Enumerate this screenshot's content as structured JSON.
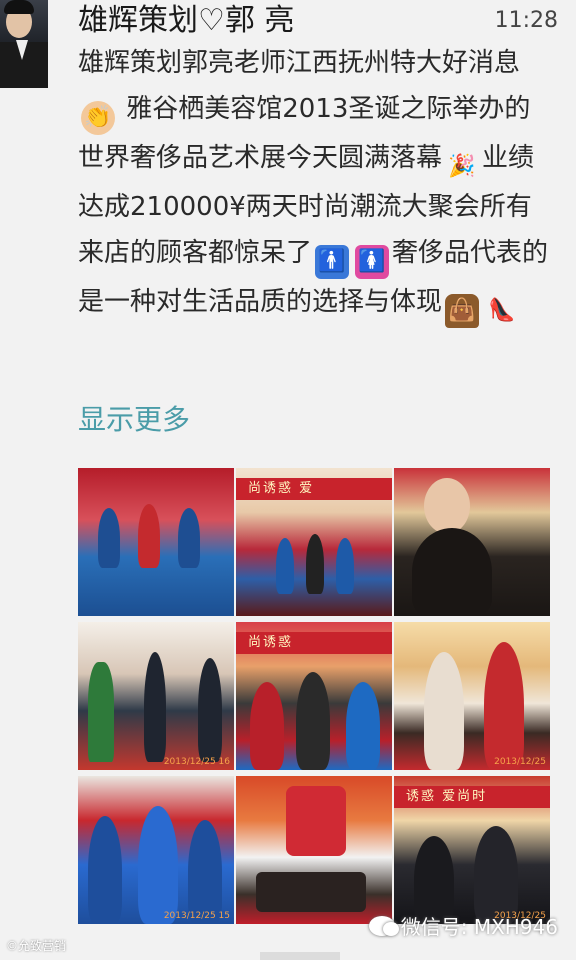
{
  "post": {
    "sender": "雄辉策划♡郭 亮",
    "time": "11:28",
    "text_1": "雄辉策划郭亮老师江西抚州特大好消息",
    "emoji_clap": "👏",
    "text_2": " 雅谷栖美容馆2013圣诞之际举办的世界奢侈品艺术展今天圆满落幕",
    "emoji_party": "🎉",
    "text_3": "业绩达成210000¥两天时尚潮流大聚会所有来店的顾客都惊呆了",
    "emoji_man": "🚹",
    "emoji_woman": "🚺",
    "text_4": "奢侈品代表的是一种对生活品质的选择与体现",
    "emoji_bag": "👜",
    "emoji_shoe": "👠",
    "show_more": "显示更多"
  },
  "photos": [
    {
      "id": "photo-1",
      "banner": "",
      "stamp": ""
    },
    {
      "id": "photo-2",
      "banner": "尚诱惑 爱",
      "stamp": ""
    },
    {
      "id": "photo-3",
      "banner": "",
      "stamp": ""
    },
    {
      "id": "photo-4",
      "banner": "",
      "stamp": "2013/12/25 16"
    },
    {
      "id": "photo-5",
      "banner": "尚诱惑",
      "stamp": ""
    },
    {
      "id": "photo-6",
      "banner": "",
      "stamp": "2013/12/25"
    },
    {
      "id": "photo-7",
      "banner": "",
      "stamp": "2013/12/25 15"
    },
    {
      "id": "photo-8",
      "banner": "",
      "stamp": ""
    },
    {
      "id": "photo-9",
      "banner": "诱惑 爱尚时",
      "stamp": "2013/12/25"
    }
  ],
  "watermark": {
    "label": "微信号: MXH946",
    "corner": "©允致营销"
  },
  "colors": {
    "background": "#f2f2f2",
    "link": "#4a9ca8",
    "banner_red": "#c8232c"
  }
}
